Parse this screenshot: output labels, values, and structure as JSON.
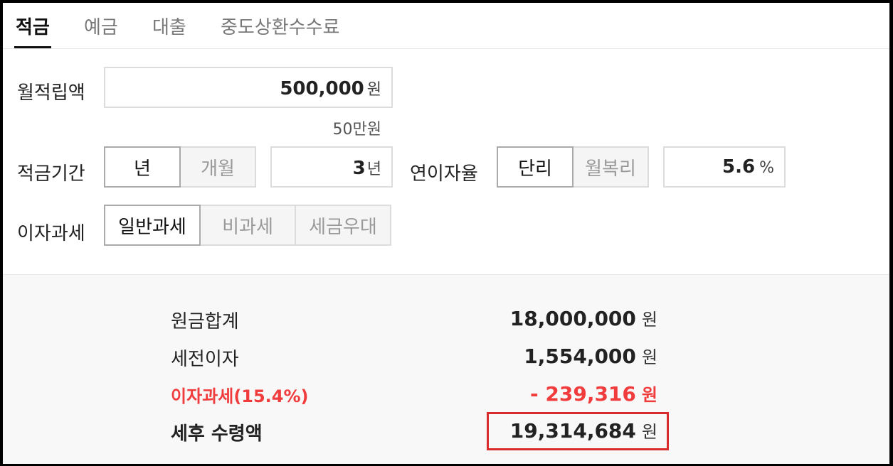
{
  "tabs": [
    {
      "label": "적금",
      "active": true
    },
    {
      "label": "예금",
      "active": false
    },
    {
      "label": "대출",
      "active": false
    },
    {
      "label": "중도상환수수료",
      "active": false
    }
  ],
  "form": {
    "monthly": {
      "label": "월적립액",
      "value": "500,000",
      "unit": "원",
      "hint": "50만원"
    },
    "period": {
      "label": "적금기간",
      "options": [
        "년",
        "개월"
      ],
      "selected": "년",
      "value": "3",
      "unit": "년"
    },
    "rate": {
      "label": "연이자율",
      "options": [
        "단리",
        "월복리"
      ],
      "selected": "단리",
      "value": "5.6",
      "unit": "%"
    },
    "tax": {
      "label": "이자과세",
      "options": [
        "일반과세",
        "비과세",
        "세금우대"
      ],
      "selected": "일반과세"
    }
  },
  "results": {
    "principal": {
      "label": "원금합계",
      "value": "18,000,000",
      "unit": "원"
    },
    "pretax_interest": {
      "label": "세전이자",
      "value": "1,554,000",
      "unit": "원"
    },
    "interest_tax": {
      "label": "이자과세(15.4%)",
      "value": "- 239,316",
      "unit": "원"
    },
    "net_amount": {
      "label": "세후 수령액",
      "value": "19,314,684",
      "unit": "원"
    }
  },
  "colors": {
    "accent_red": "#f03c3c",
    "highlight_border": "#d92b2b"
  }
}
